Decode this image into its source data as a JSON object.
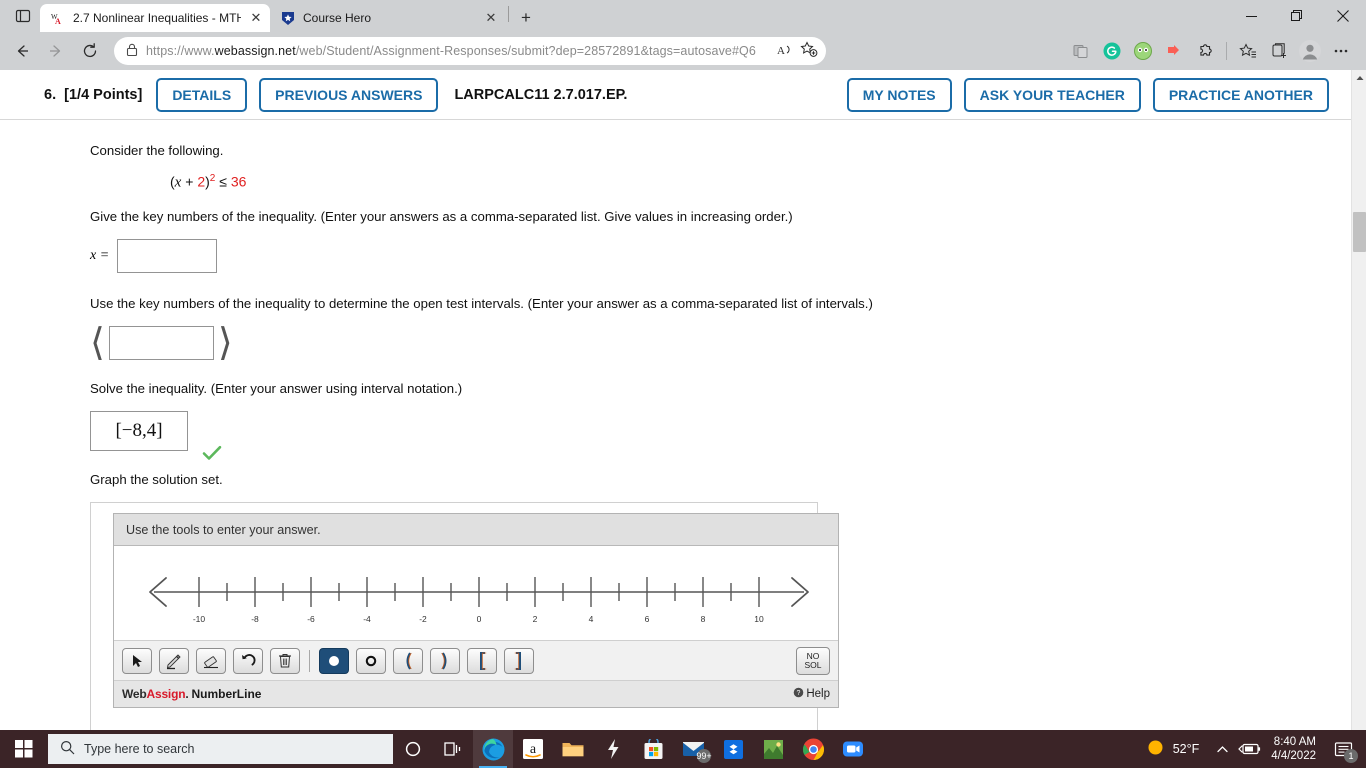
{
  "browser": {
    "tabs": [
      {
        "title": "2.7 Nonlinear Inequalities - MTH",
        "favicon": "webassign-icon",
        "active": true
      },
      {
        "title": "Course Hero",
        "favicon": "coursehero-icon",
        "active": false
      }
    ],
    "newtab_label": "+",
    "window_controls": {
      "minimize": "—",
      "maximize": "❐",
      "close": "✕"
    },
    "nav": {
      "back": "←",
      "forward": "→",
      "reload": "↻"
    },
    "address": {
      "lock_icon": "lock-icon",
      "url_prefix": "https://www.",
      "url_domain": "webassign.net",
      "url_path": "/web/Student/Assignment-Responses/submit?dep=28572891&tags=autosave#Q6",
      "read_aloud_icon": "read-aloud-icon",
      "add_favorite_icon": "add-favorite-icon"
    },
    "extensions": [
      "split-screen-icon",
      "grammarly-icon",
      "honey-icon",
      "pinterest-icon",
      "puzzle-piece-icon"
    ],
    "right_icons": [
      "favorites-icon",
      "collections-icon",
      "profile-icon",
      "settings-more-icon"
    ]
  },
  "question": {
    "number": "6.",
    "points": "[1/4 Points]",
    "details_label": "DETAILS",
    "previous_answers_label": "PREVIOUS ANSWERS",
    "code": "LARPCALC11 2.7.017.EP.",
    "my_notes_label": "MY NOTES",
    "ask_teacher_label": "ASK YOUR TEACHER",
    "practice_another_label": "PRACTICE ANOTHER"
  },
  "content": {
    "consider_text": "Consider the following.",
    "equation": {
      "lhs_open": "(",
      "var": "x",
      "plus": " + ",
      "const": "2",
      "rhs_close": ")",
      "exponent": "2",
      "relation": " ≤ ",
      "value": "36"
    },
    "key_numbers_prompt": "Give the key numbers of the inequality. (Enter your answers as a comma-separated list. Give values in increasing order.)",
    "x_label": "x =",
    "x_value": "",
    "x_placeholder": "",
    "test_intervals_prompt": "Use the key numbers of the inequality to determine the open test intervals. (Enter your answer as a comma-separated list of intervals.)",
    "intervals_value": "",
    "intervals_left_bracket": "⟨",
    "intervals_right_bracket": "⟩",
    "solve_prompt": "Solve the inequality. (Enter your answer using interval notation.)",
    "solution_value": "[−8,4]",
    "solution_correct_icon": "green-check-icon",
    "graph_prompt": "Graph the solution set."
  },
  "numberline": {
    "instruction": "Use the tools to enter your answer.",
    "tools": [
      {
        "name": "select-tool",
        "glyph": "➤",
        "selected": false
      },
      {
        "name": "pencil-tool",
        "glyph": "✎",
        "selected": false
      },
      {
        "name": "eraser-tool",
        "glyph": "▭",
        "selected": false
      },
      {
        "name": "undo-tool",
        "glyph": "↶",
        "selected": false
      },
      {
        "name": "trash-tool",
        "glyph": "🗑",
        "selected": false
      },
      {
        "name": "closed-dot-tool",
        "glyph": "●",
        "selected": true
      },
      {
        "name": "open-dot-tool",
        "glyph": "○",
        "selected": false
      },
      {
        "name": "open-paren-left-tool",
        "glyph": "(",
        "selected": false
      },
      {
        "name": "open-paren-right-tool",
        "glyph": ")",
        "selected": false
      },
      {
        "name": "bracket-left-tool",
        "glyph": "[",
        "selected": false
      },
      {
        "name": "bracket-right-tool",
        "glyph": "]",
        "selected": false
      }
    ],
    "no_solution_line1": "NO",
    "no_solution_line2": "SOL",
    "brand_web": "Web",
    "brand_assign": "Assign",
    "brand_dot": ".",
    "product": "NumberLine",
    "help_label": "Help",
    "axis": {
      "min": -11,
      "max": 11,
      "major_ticks": [
        -10,
        -8,
        -6,
        -4,
        -2,
        0,
        2,
        4,
        6,
        8,
        10
      ],
      "minor_ticks": [
        -9,
        -7,
        -5,
        -3,
        -1,
        1,
        3,
        5,
        7,
        9
      ],
      "labels": [
        "-10",
        "-8",
        "-6",
        "-4",
        "-2",
        "0",
        "2",
        "4",
        "6",
        "8",
        "10"
      ],
      "left_arrow": true,
      "right_arrow": true
    }
  },
  "taskbar": {
    "start_icon": "windows-start-icon",
    "search_placeholder": "Type here to search",
    "search_icon": "search-icon",
    "icons": [
      {
        "name": "cortana-icon",
        "glyph": "○"
      },
      {
        "name": "task-view-icon",
        "glyph": "⌸"
      },
      {
        "name": "edge-icon",
        "glyph": "e",
        "active": true
      },
      {
        "name": "amazon-icon",
        "glyph": "a"
      },
      {
        "name": "file-explorer-icon",
        "glyph": "📁"
      },
      {
        "name": "flash-app-icon",
        "glyph": "⚡"
      },
      {
        "name": "microsoft-store-icon",
        "glyph": "🛍"
      },
      {
        "name": "mail-icon",
        "glyph": "✉",
        "badge": "99+"
      },
      {
        "name": "dropbox-icon",
        "glyph": "❖"
      },
      {
        "name": "photos-icon",
        "glyph": "🏞"
      },
      {
        "name": "chrome-icon",
        "glyph": "◉"
      },
      {
        "name": "zoom-icon",
        "glyph": "📹"
      }
    ],
    "weather_temp": "52°F",
    "weather_icon": "sun-icon",
    "chevron_up": "⌃",
    "battery_icon": "battery-charging-icon",
    "time": "8:40 AM",
    "date": "4/4/2022",
    "notification_icon": "notification-icon",
    "notification_count": "1"
  },
  "colors": {
    "accent_blue": "#1b6ca8",
    "error_red": "#e02020",
    "brand_red": "#d81a2b",
    "taskbar_bg": "#3b2427",
    "correct_green": "#5cb85c",
    "tool_selected": "#1f4e79"
  }
}
